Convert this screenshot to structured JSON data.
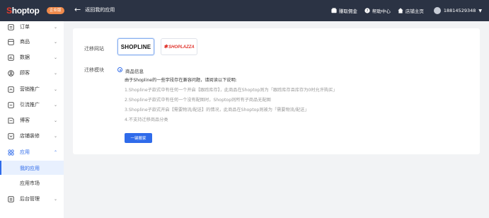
{
  "topbar": {
    "logo_s": "S",
    "logo_rest": "hoptop",
    "badge": "企业版",
    "back_label": "返回我的应用",
    "links": [
      {
        "label": "赚取佣金",
        "icon": "wallet-icon"
      },
      {
        "label": "帮助中心",
        "icon": "help-icon"
      },
      {
        "label": "店铺主页",
        "icon": "home-icon"
      }
    ],
    "user": "18814529348"
  },
  "sidebar": {
    "items": [
      {
        "label": "订单",
        "icon": "order-icon"
      },
      {
        "label": "商品",
        "icon": "product-icon"
      },
      {
        "label": "数据",
        "icon": "data-icon"
      },
      {
        "label": "顾客",
        "icon": "customer-icon"
      },
      {
        "label": "营销推广",
        "icon": "marketing-icon"
      },
      {
        "label": "引流推广",
        "icon": "traffic-icon"
      },
      {
        "label": "博客",
        "icon": "blog-icon"
      },
      {
        "label": "店铺装修",
        "icon": "decoration-icon"
      },
      {
        "label": "应用",
        "icon": "apps-icon"
      }
    ],
    "sub_items": [
      {
        "label": "我的应用",
        "active": true
      },
      {
        "label": "应用市场",
        "active": false
      }
    ],
    "bottom_item": {
      "label": "后台管理",
      "icon": "admin-icon"
    }
  },
  "main": {
    "site_label": "迁移网站",
    "platforms": [
      {
        "name": "SHOPLINE",
        "selected": true
      },
      {
        "name": "SHOPLAZZA",
        "selected": false
      }
    ],
    "module_label": "迁移模块",
    "module_option": "商品信息",
    "intro": "由于Shopline的一些字段存在兼容问题，请阅读以下说明:",
    "notes": [
      "1.Shopline子款式中有任何一个开启【跟踪库存】，此商品在Shoptop则为「跟踪库存且库存为0时允许购买」",
      "2.Shopline子款式中有任何一个没有配图时，Shoptop则所有子商品无配图",
      "3.Shopline子款式开启【需要物流/配送】的情况，此商品在Shoptop则被为「需要物流/配送」",
      "4.不支持迁移商品分类"
    ],
    "button": "一键搬家"
  },
  "colors": {
    "topbar": "#2b3344",
    "accent": "#2f6bea",
    "brand_red": "#e83b2c",
    "badge": "#f08a4b"
  }
}
